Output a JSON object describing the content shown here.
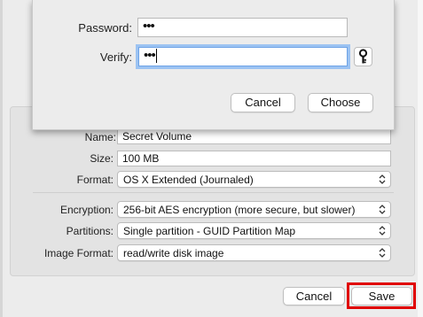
{
  "password_sheet": {
    "password_label": "Password:",
    "password_value": "•••",
    "verify_label": "Verify:",
    "verify_value": "•••",
    "cancel_label": "Cancel",
    "choose_label": "Choose"
  },
  "form": {
    "name_label": "Name:",
    "name_value": "Secret Volume",
    "size_label": "Size:",
    "size_value": "100 MB",
    "format_label": "Format:",
    "format_value": "OS X Extended (Journaled)",
    "encryption_label": "Encryption:",
    "encryption_value": "256-bit AES encryption (more secure, but slower)",
    "partitions_label": "Partitions:",
    "partitions_value": "Single partition - GUID Partition Map",
    "image_format_label": "Image Format:",
    "image_format_value": "read/write disk image"
  },
  "footer": {
    "cancel_label": "Cancel",
    "save_label": "Save"
  },
  "icons": {
    "key": "key-icon",
    "popup_arrows": "updown-chevron-icon"
  },
  "colors": {
    "highlight": "#e00000",
    "focus_ring": "#9cc3f2"
  }
}
